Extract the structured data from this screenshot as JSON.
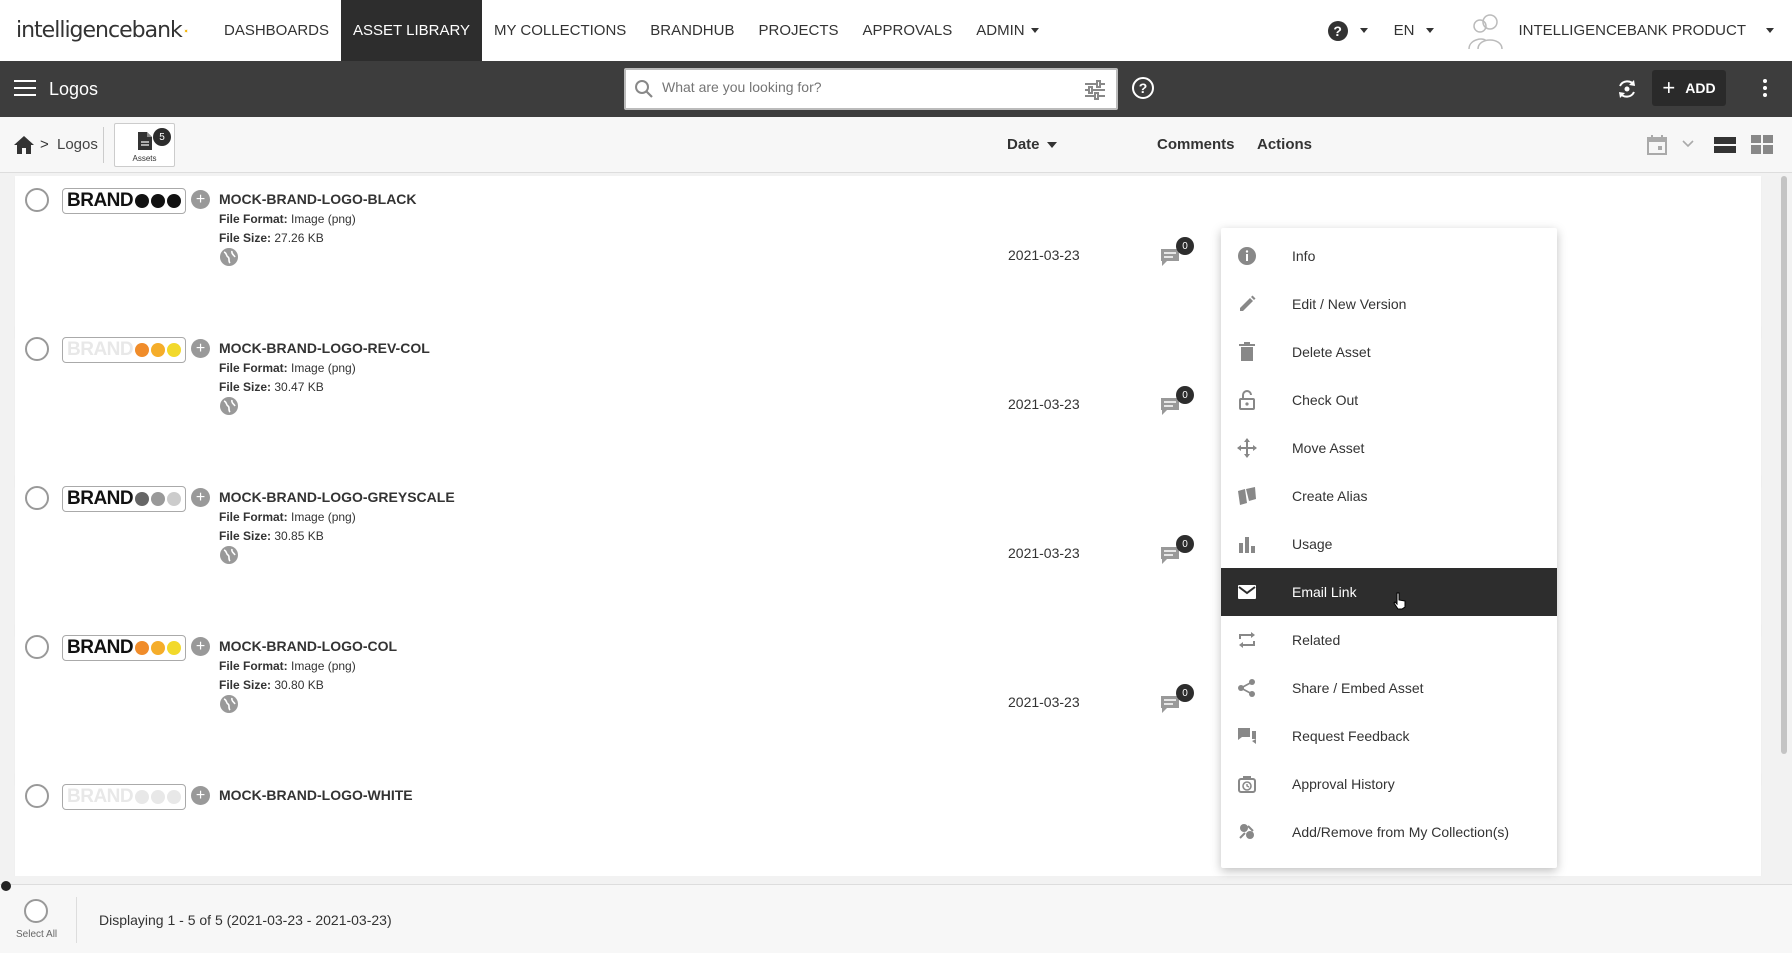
{
  "brand": {
    "logo_text": "intelligencebank"
  },
  "nav": {
    "items": [
      {
        "label": "DASHBOARDS",
        "active": false,
        "dropdown": false
      },
      {
        "label": "ASSET LIBRARY",
        "active": true,
        "dropdown": false
      },
      {
        "label": "MY COLLECTIONS",
        "active": false,
        "dropdown": false
      },
      {
        "label": "BRANDHUB",
        "active": false,
        "dropdown": false
      },
      {
        "label": "PROJECTS",
        "active": false,
        "dropdown": false
      },
      {
        "label": "APPROVALS",
        "active": false,
        "dropdown": false
      },
      {
        "label": "ADMIN",
        "active": false,
        "dropdown": true
      }
    ],
    "help_symbol": "?",
    "language": "EN",
    "user_name": "INTELLIGENCEBANK PRODUCT"
  },
  "toolbar": {
    "title": "Logos",
    "search_placeholder": "What are you looking for?",
    "help_symbol": "?",
    "add_label": "ADD",
    "add_symbol": "+"
  },
  "subbar": {
    "breadcrumb_sep": ">",
    "breadcrumb_current": "Logos",
    "assets_label": "Assets",
    "assets_count": "5",
    "col_date": "Date",
    "col_comments": "Comments",
    "col_actions": "Actions"
  },
  "labels": {
    "file_format": "File Format:",
    "file_size": "File Size:"
  },
  "assets": [
    {
      "title": "MOCK-BRAND-LOGO-BLACK",
      "file_format": "Image (png)",
      "file_size": "27.26 KB",
      "date": "2021-03-23",
      "comments": "0",
      "thumb_text": "BRAND",
      "thumb_text_color": "#111111",
      "dots": [
        "#111111",
        "#111111",
        "#111111"
      ]
    },
    {
      "title": "MOCK-BRAND-LOGO-REV-COL",
      "file_format": "Image (png)",
      "file_size": "30.47 KB",
      "date": "2021-03-23",
      "comments": "0",
      "thumb_text": "BRAND",
      "thumb_text_color": "#e8e8e8",
      "dots": [
        "#f08c2a",
        "#f5ad2a",
        "#f2d92b"
      ]
    },
    {
      "title": "MOCK-BRAND-LOGO-GREYSCALE",
      "file_format": "Image (png)",
      "file_size": "30.85 KB",
      "date": "2021-03-23",
      "comments": "0",
      "thumb_text": "BRAND",
      "thumb_text_color": "#111111",
      "dots": [
        "#666666",
        "#999999",
        "#cccccc"
      ]
    },
    {
      "title": "MOCK-BRAND-LOGO-COL",
      "file_format": "Image (png)",
      "file_size": "30.80 KB",
      "date": "2021-03-23",
      "comments": "0",
      "thumb_text": "BRAND",
      "thumb_text_color": "#111111",
      "dots": [
        "#f08c2a",
        "#f5ad2a",
        "#f2d92b"
      ]
    },
    {
      "title": "MOCK-BRAND-LOGO-WHITE",
      "file_format": "",
      "file_size": "",
      "date": "",
      "comments": "",
      "thumb_text": "BRAND",
      "thumb_text_color": "#e8e8e8",
      "dots": [
        "#e8e8e8",
        "#e8e8e8",
        "#e8e8e8"
      ]
    }
  ],
  "actions_menu": [
    {
      "label": "Info",
      "icon": "info-icon",
      "active": false
    },
    {
      "label": "Edit / New Version",
      "icon": "pencil-icon",
      "active": false
    },
    {
      "label": "Delete Asset",
      "icon": "trash-icon",
      "active": false
    },
    {
      "label": "Check Out",
      "icon": "lock-icon",
      "active": false
    },
    {
      "label": "Move Asset",
      "icon": "move-icon",
      "active": false
    },
    {
      "label": "Create Alias",
      "icon": "alias-icon",
      "active": false
    },
    {
      "label": "Usage",
      "icon": "bar-chart-icon",
      "active": false
    },
    {
      "label": "Email Link",
      "icon": "email-icon",
      "active": true
    },
    {
      "label": "Related",
      "icon": "repeat-icon",
      "active": false
    },
    {
      "label": "Share / Embed Asset",
      "icon": "share-icon",
      "active": false
    },
    {
      "label": "Request Feedback",
      "icon": "feedback-icon",
      "active": false
    },
    {
      "label": "Approval History",
      "icon": "history-icon",
      "active": false
    },
    {
      "label": "Add/Remove from My Collection(s)",
      "icon": "collection-icon",
      "active": false
    }
  ],
  "footer": {
    "select_all_label": "Select All",
    "display_text": "Displaying 1 - 5 of 5 (2021-03-23 - 2021-03-23)"
  },
  "colors": {
    "nav_active_bg": "#2d2d2d",
    "toolbar_bg": "#3d3d3d",
    "menu_active_bg": "#2d2d2d",
    "logo_sun": "#f5b400"
  }
}
